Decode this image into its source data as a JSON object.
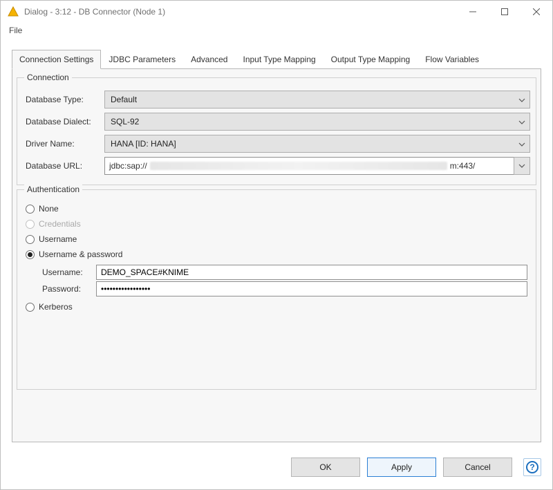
{
  "window": {
    "title": "Dialog - 3:12 - DB Connector (Node 1)"
  },
  "menu": {
    "file": "File"
  },
  "tabs": [
    "Connection Settings",
    "JDBC Parameters",
    "Advanced",
    "Input Type Mapping",
    "Output Type Mapping",
    "Flow Variables"
  ],
  "connection": {
    "legend": "Connection",
    "db_type_label": "Database Type:",
    "db_type_value": "Default",
    "dialect_label": "Database Dialect:",
    "dialect_value": "SQL-92",
    "driver_label": "Driver Name:",
    "driver_value": "HANA [ID: HANA]",
    "url_label": "Database URL:",
    "url_prefix": "jdbc:sap://",
    "url_suffix": "m:443/"
  },
  "auth": {
    "legend": "Authentication",
    "none": "None",
    "credentials": "Credentials",
    "username": "Username",
    "username_password": "Username & password",
    "kerberos": "Kerberos",
    "selected": "username_password",
    "username_label": "Username:",
    "username_value": "DEMO_SPACE#KNIME",
    "password_label": "Password:",
    "password_value": "•••••••••••••••••"
  },
  "buttons": {
    "ok": "OK",
    "apply": "Apply",
    "cancel": "Cancel"
  }
}
